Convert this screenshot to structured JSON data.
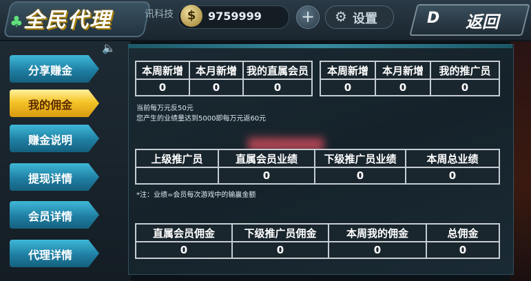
{
  "header": {
    "title": "全民代理",
    "company": "讯科技",
    "coins": "9759999",
    "add_label": "+",
    "settings_label": "设置",
    "back_label": "返回",
    "back_logo": "D"
  },
  "sidebar": {
    "items": [
      {
        "label": "分享赚金",
        "active": false
      },
      {
        "label": "我的佣金",
        "active": true
      },
      {
        "label": "赚金说明",
        "active": false
      },
      {
        "label": "提现详情",
        "active": false
      },
      {
        "label": "会员详情",
        "active": false
      },
      {
        "label": "代理详情",
        "active": false
      }
    ]
  },
  "stats": {
    "table1": {
      "headers": [
        "本周新增",
        "本月新增",
        "我的直属会员"
      ],
      "values": [
        "0",
        "0",
        "0"
      ]
    },
    "table2": {
      "headers": [
        "本周新增",
        "本月新增",
        "我的推广员"
      ],
      "values": [
        "0",
        "0",
        "0"
      ]
    },
    "rebate_note_1": "当前每万元反50元",
    "rebate_note_2": "您产生的业绩量达到5000即每万元返60元",
    "table3": {
      "headers": [
        "上级推广员",
        "直属会员业绩",
        "下级推广员业绩",
        "本周总业绩"
      ],
      "values": [
        "",
        "0",
        "0",
        "0"
      ]
    },
    "performance_note": "*注：业绩=会员每次游戏中的输赢金额",
    "table4": {
      "headers": [
        "直属会员佣金",
        "下级推广员佣金",
        "本周我的佣金",
        "总佣金"
      ],
      "values": [
        "0",
        "0",
        "0",
        "0"
      ]
    }
  }
}
